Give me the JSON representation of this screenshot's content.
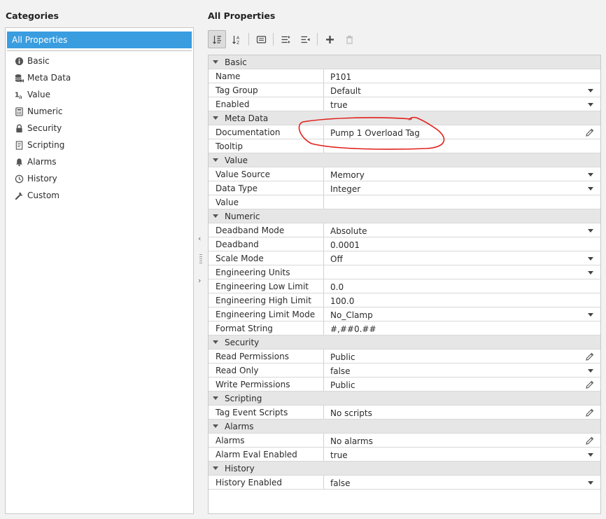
{
  "categories_header": "Categories",
  "properties_header": "All Properties",
  "categories": [
    {
      "label": "All Properties",
      "icon": "",
      "selected": true
    },
    {
      "label": "Basic",
      "icon": "info-icon"
    },
    {
      "label": "Meta Data",
      "icon": "database-icon"
    },
    {
      "label": "Value",
      "icon": "value-icon"
    },
    {
      "label": "Numeric",
      "icon": "calculator-icon"
    },
    {
      "label": "Security",
      "icon": "lock-icon"
    },
    {
      "label": "Scripting",
      "icon": "script-icon"
    },
    {
      "label": "Alarms",
      "icon": "bell-icon"
    },
    {
      "label": "History",
      "icon": "clock-icon"
    },
    {
      "label": "Custom",
      "icon": "wrench-icon"
    }
  ],
  "toolbar": {
    "buttons": [
      "sort-category-icon",
      "sort-alpha-icon",
      "description-icon",
      "expand-all-icon",
      "collapse-all-icon",
      "add-icon",
      "delete-icon"
    ]
  },
  "sections": [
    {
      "name": "Basic",
      "rows": [
        {
          "key": "Name",
          "value": "P101",
          "control": "text"
        },
        {
          "key": "Tag Group",
          "value": "Default",
          "control": "dropdown"
        },
        {
          "key": "Enabled",
          "value": "true",
          "control": "dropdown"
        }
      ]
    },
    {
      "name": "Meta Data",
      "rows": [
        {
          "key": "Documentation",
          "value": "Pump 1 Overload Tag",
          "control": "edit"
        },
        {
          "key": "Tooltip",
          "value": "",
          "control": "text"
        }
      ]
    },
    {
      "name": "Value",
      "rows": [
        {
          "key": "Value Source",
          "value": "Memory",
          "control": "dropdown"
        },
        {
          "key": "Data Type",
          "value": "Integer",
          "control": "dropdown"
        },
        {
          "key": "Value",
          "value": "",
          "control": "text"
        }
      ]
    },
    {
      "name": "Numeric",
      "rows": [
        {
          "key": "Deadband Mode",
          "value": "Absolute",
          "control": "dropdown"
        },
        {
          "key": "Deadband",
          "value": "0.0001",
          "control": "text"
        },
        {
          "key": "Scale Mode",
          "value": "Off",
          "control": "dropdown"
        },
        {
          "key": "Engineering Units",
          "value": "",
          "control": "dropdown"
        },
        {
          "key": "Engineering Low Limit",
          "value": "0.0",
          "control": "text"
        },
        {
          "key": "Engineering High Limit",
          "value": "100.0",
          "control": "text"
        },
        {
          "key": "Engineering Limit Mode",
          "value": "No_Clamp",
          "control": "dropdown"
        },
        {
          "key": "Format String",
          "value": "#,##0.##",
          "control": "text"
        }
      ]
    },
    {
      "name": "Security",
      "rows": [
        {
          "key": "Read Permissions",
          "value": "Public",
          "control": "edit"
        },
        {
          "key": "Read Only",
          "value": "false",
          "control": "dropdown"
        },
        {
          "key": "Write Permissions",
          "value": "Public",
          "control": "edit"
        }
      ]
    },
    {
      "name": "Scripting",
      "rows": [
        {
          "key": "Tag Event Scripts",
          "value": "No scripts",
          "control": "edit"
        }
      ]
    },
    {
      "name": "Alarms",
      "rows": [
        {
          "key": "Alarms",
          "value": "No alarms",
          "control": "edit"
        },
        {
          "key": "Alarm Eval Enabled",
          "value": "true",
          "control": "dropdown"
        }
      ]
    },
    {
      "name": "History",
      "rows": [
        {
          "key": "History Enabled",
          "value": "false",
          "control": "dropdown"
        }
      ]
    }
  ]
}
